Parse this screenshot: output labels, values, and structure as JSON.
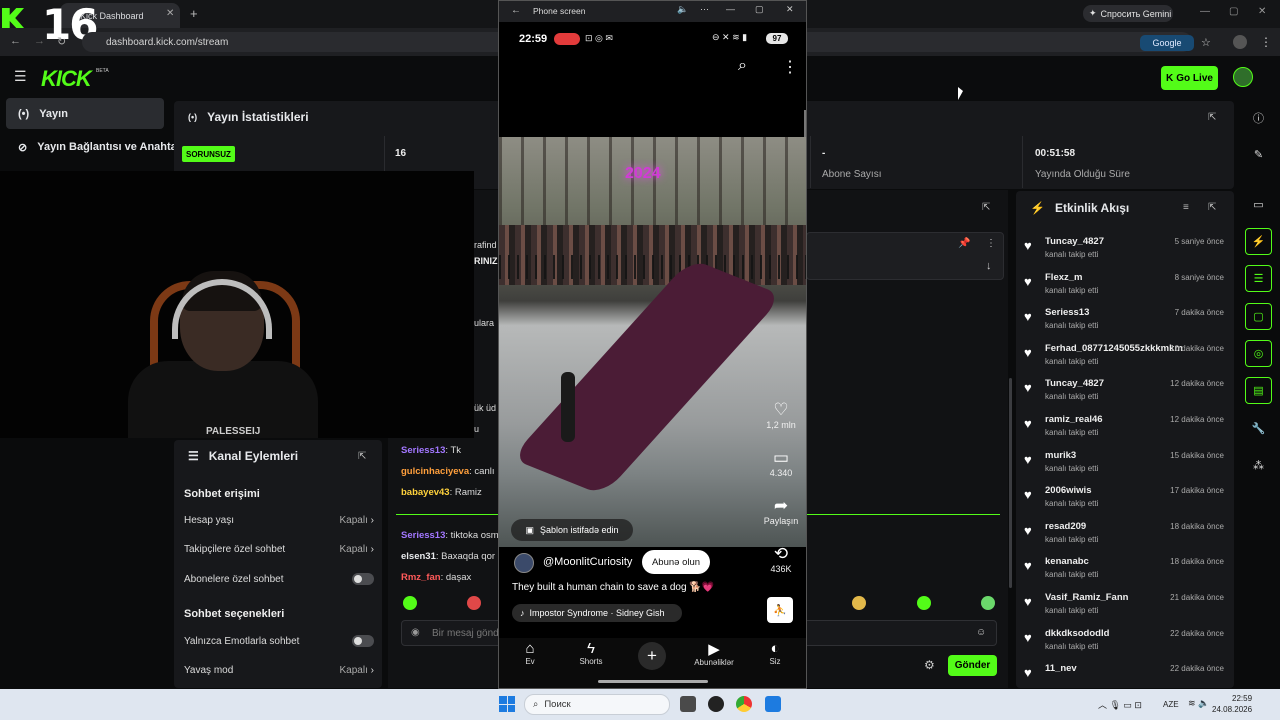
{
  "browser": {
    "tab_title": "Kick Dashboard",
    "address": "dashboard.kick.com/stream",
    "gemini_label": "Спросить Gemini",
    "google_chip": "Google"
  },
  "overlay": {
    "stream_number": "16"
  },
  "kick": {
    "logo": "KICK",
    "beta": "BETA",
    "go_live": "Go Live",
    "sidebar": [
      {
        "label": "Yayın"
      },
      {
        "label": "Yayın Bağlantısı ve Anahtarı"
      }
    ]
  },
  "stats": {
    "title": "Yayın İstatistikleri",
    "status": "SORUNSUZ",
    "viewers": "16",
    "subs_value": "-",
    "subs_label": "Abone Sayısı",
    "uptime_value": "00:51:58",
    "uptime_label": "Yayında Olduğu Süre"
  },
  "webcam": {
    "shirt_text": "PALESSEIJ"
  },
  "chat": {
    "fragments": [
      "rafind",
      "RINIZ",
      "ulara",
      "ük üd",
      "u"
    ],
    "messages": [
      {
        "user": "Seriess13",
        "text": "Tk",
        "color": "#a277ff"
      },
      {
        "user": "gulcinhaciyeva",
        "text": "canlı",
        "color": "#ff9f3c"
      },
      {
        "user": "babayev43",
        "text": "Ramiz",
        "color": "#ffd23c"
      },
      {
        "user": "Seriess13",
        "text": "tiktoka osm",
        "color": "#a277ff"
      },
      {
        "user": "elsen31",
        "text": "Baxaqda qor",
        "color": "#e7e9ec"
      },
      {
        "user": "Rmz_fan",
        "text": "daşax",
        "color": "#ff5a5a"
      }
    ],
    "input_placeholder": "Bir mesaj gönder",
    "send": "Gönder"
  },
  "channel_actions": {
    "title": "Kanal Eylemleri",
    "section_access": "Sohbet erişimi",
    "section_options": "Sohbet seçenekleri",
    "rows": [
      {
        "label": "Hesap yaşı",
        "value": "Kapalı"
      },
      {
        "label": "Takipçilere özel sohbet",
        "value": "Kapalı"
      },
      {
        "label": "Abonelere özel sohbet",
        "value": ""
      },
      {
        "label": "Yalnızca Emotlarla sohbet",
        "value": ""
      },
      {
        "label": "Yavaş mod",
        "value": "Kapalı"
      }
    ]
  },
  "events": {
    "title": "Etkinlik Akışı",
    "items": [
      {
        "user": "Tuncay_4827",
        "action": "kanalı takip etti",
        "time": "5 saniye önce"
      },
      {
        "user": "Flexz_m",
        "action": "kanalı takip etti",
        "time": "8 saniye önce"
      },
      {
        "user": "Seriess13",
        "action": "kanalı takip etti",
        "time": "7 dakika önce"
      },
      {
        "user": "Ferhad_08771245055zkkkmkm",
        "action": "kanalı takip etti",
        "time": "10 dakika önce"
      },
      {
        "user": "Tuncay_4827",
        "action": "kanalı takip etti",
        "time": "12 dakika önce"
      },
      {
        "user": "ramiz_real46",
        "action": "kanalı takip etti",
        "time": "12 dakika önce"
      },
      {
        "user": "murik3",
        "action": "kanalı takip etti",
        "time": "15 dakika önce"
      },
      {
        "user": "2006wiwis",
        "action": "kanalı takip etti",
        "time": "17 dakika önce"
      },
      {
        "user": "resad209",
        "action": "kanalı takip etti",
        "time": "18 dakika önce"
      },
      {
        "user": "kenanabc",
        "action": "kanalı takip etti",
        "time": "18 dakika önce"
      },
      {
        "user": "Vasif_Ramiz_Fann",
        "action": "kanalı takip etti",
        "time": "21 dakika önce"
      },
      {
        "user": "dkkdksododld",
        "action": "kanalı takip etti",
        "time": "22 dakika önce"
      },
      {
        "user": "11_nev",
        "action": "",
        "time": "22 dakika önce"
      }
    ]
  },
  "phone": {
    "window_title": "Phone screen",
    "time": "22:59",
    "battery": "97",
    "video_year": "2024",
    "likes": "1,2 mln",
    "comments": "4.340",
    "share": "Paylaşın",
    "remix_count": "436K",
    "template_chip": "Şablon istifadə edin",
    "channel": "@MoonlitCuriosity",
    "subscribe": "Abunə olun",
    "video_title": "They built a human chain to save a dog 🐕💗",
    "music": "Impostor Syndrome · Sidney Gish",
    "nav": [
      {
        "label": "Ev"
      },
      {
        "label": "Shorts"
      },
      {
        "label": "Abunəliklər"
      },
      {
        "label": "Siz"
      }
    ]
  },
  "taskbar": {
    "search": "Поиск",
    "lang": "AZE",
    "time": "22:59",
    "date": "24.08.2026"
  },
  "colors": {
    "accent": "#53fc18",
    "panel": "#17181b",
    "background": "#0a0b0c"
  }
}
